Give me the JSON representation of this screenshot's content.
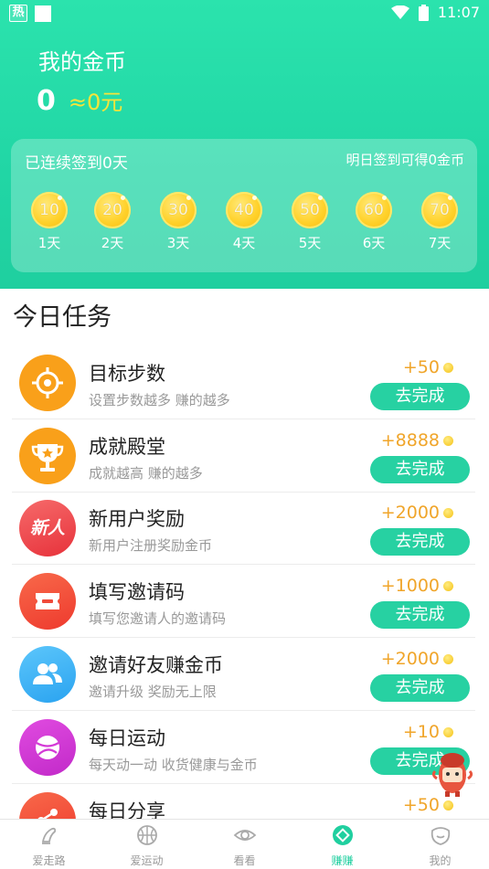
{
  "status_bar": {
    "hot_badge": "热",
    "time": "11:07"
  },
  "wallet": {
    "title": "我的金币",
    "coins": "0",
    "rmb": "≈0元"
  },
  "signin": {
    "streak_text": "已连续签到0天",
    "tomorrow_text": "明日签到可得0金币",
    "days": [
      {
        "coin": "10",
        "label": "1天"
      },
      {
        "coin": "20",
        "label": "2天"
      },
      {
        "coin": "30",
        "label": "3天"
      },
      {
        "coin": "40",
        "label": "4天"
      },
      {
        "coin": "50",
        "label": "5天"
      },
      {
        "coin": "60",
        "label": "6天"
      },
      {
        "coin": "70",
        "label": "7天"
      }
    ]
  },
  "tasks_title": "今日任务",
  "tasks": [
    {
      "icon": "target-icon",
      "color": "#f9a01a",
      "title": "目标步数",
      "desc": "设置步数越多 赚的越多",
      "reward": "+50",
      "button": "去完成"
    },
    {
      "icon": "trophy-icon",
      "color": "#f9a01a",
      "title": "成就殿堂",
      "desc": "成就越高 赚的越多",
      "reward": "+8888",
      "button": "去完成"
    },
    {
      "icon": "new-user-icon",
      "color": "#f04a4e",
      "icon_text": "新人",
      "title": "新用户奖励",
      "desc": "新用户注册奖励金币",
      "reward": "+2000",
      "button": "去完成"
    },
    {
      "icon": "ticket-icon",
      "color": "#f5533a",
      "title": "填写邀请码",
      "desc": "填写您邀请人的邀请码",
      "reward": "+1000",
      "button": "去完成"
    },
    {
      "icon": "friends-icon",
      "color": "#3fb0f5",
      "title": "邀请好友赚金币",
      "desc": "邀请升级 奖励无上限",
      "reward": "+2000",
      "button": "去完成"
    },
    {
      "icon": "ball-icon",
      "color": "#d63ad6",
      "title": "每日运动",
      "desc": "每天动一动 收货健康与金币",
      "reward": "+10",
      "button": "去完成"
    },
    {
      "icon": "share-icon",
      "color": "#f5533a",
      "title": "每日分享",
      "desc": "",
      "reward": "+50",
      "button": ""
    }
  ],
  "tabbar": [
    {
      "icon": "walk-icon",
      "label": "爱走路",
      "active": false
    },
    {
      "icon": "basketball-icon",
      "label": "爱运动",
      "active": false
    },
    {
      "icon": "eye-icon",
      "label": "看看",
      "active": false
    },
    {
      "icon": "earn-icon",
      "label": "赚赚",
      "active": true
    },
    {
      "icon": "profile-icon",
      "label": "我的",
      "active": false
    }
  ],
  "colors": {
    "accent": "#1fcf9f",
    "reward": "#f0a52a",
    "coin": "#ffd12a"
  }
}
